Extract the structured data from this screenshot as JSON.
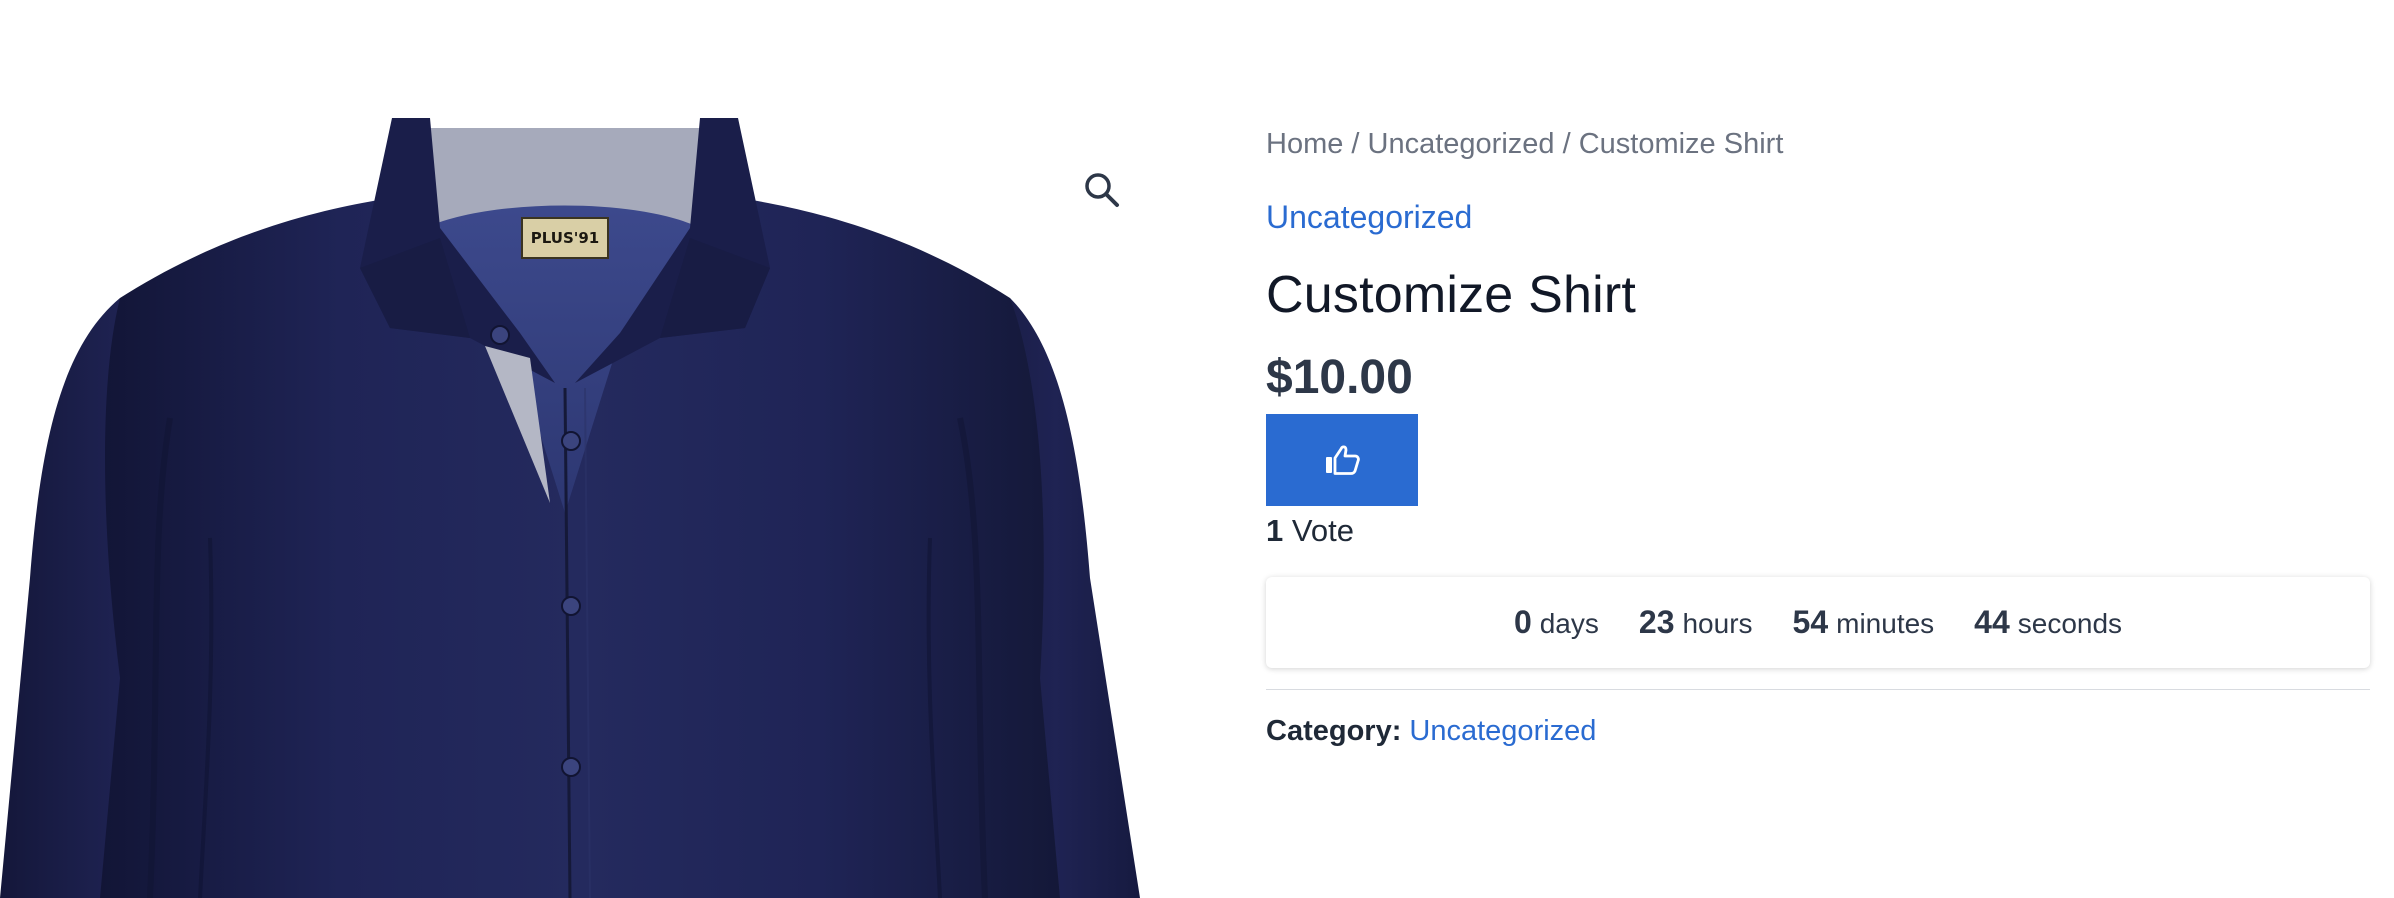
{
  "breadcrumb": {
    "home": "Home",
    "separator": " / ",
    "category": "Uncategorized",
    "current": "Customize Shirt"
  },
  "product": {
    "category_link": "Uncategorized",
    "title": "Customize Shirt",
    "price": "$10.00",
    "image_label": "PLUS'91",
    "zoom_icon": "magnifier-icon",
    "vote_icon": "thumbs-up-icon"
  },
  "votes": {
    "count": "1",
    "label": "Vote"
  },
  "countdown": {
    "days_value": "0",
    "days_label": "days",
    "hours_value": "23",
    "hours_label": "hours",
    "minutes_value": "54",
    "minutes_label": "minutes",
    "seconds_value": "44",
    "seconds_label": "seconds"
  },
  "meta": {
    "category_label": "Category:",
    "category_value": "Uncategorized"
  },
  "colors": {
    "accent": "#2a6bd1",
    "shirt": "#1d2150",
    "collar_inner": "#9ea3b6"
  }
}
